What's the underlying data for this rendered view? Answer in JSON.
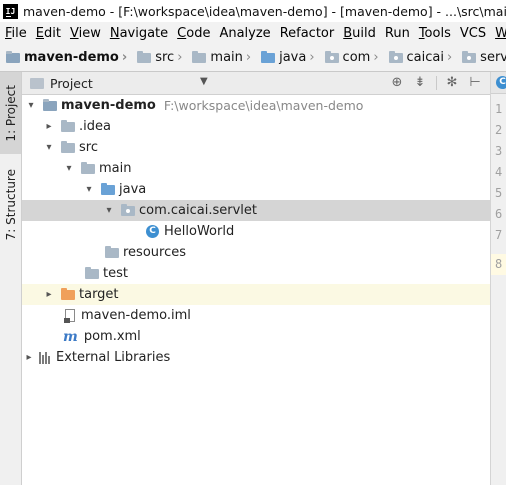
{
  "window": {
    "logo": "IJ",
    "title": "maven-demo - [F:\\workspace\\idea\\maven-demo] - [maven-demo] - ...\\src\\main\\java"
  },
  "menu": [
    {
      "mn": "F",
      "rest": "ile"
    },
    {
      "mn": "E",
      "rest": "dit"
    },
    {
      "mn": "V",
      "rest": "iew"
    },
    {
      "mn": "N",
      "rest": "avigate"
    },
    {
      "mn": "C",
      "rest": "ode"
    },
    {
      "mn": "",
      "rest": "Analyze"
    },
    {
      "mn": "",
      "rest": "Refactor"
    },
    {
      "mn": "B",
      "rest": "uild"
    },
    {
      "mn": "",
      "rest": "Run"
    },
    {
      "mn": "T",
      "rest": "ools"
    },
    {
      "mn": "",
      "rest": "VCS"
    },
    {
      "mn": "W",
      "rest": ""
    }
  ],
  "breadcrumbs": [
    "maven-demo",
    "src",
    "main",
    "java",
    "com",
    "caicai",
    "servlet",
    "C"
  ],
  "sidebar": {
    "project_tab": "1: Project",
    "structure_tab": "7: Structure"
  },
  "project_panel": {
    "title": "Project",
    "tools": [
      "target-icon",
      "collapse-icon",
      "gear-icon",
      "hide-icon"
    ]
  },
  "tree": {
    "root": {
      "label": "maven-demo",
      "path": "F:\\workspace\\idea\\maven-demo"
    },
    "idea": ".idea",
    "src": "src",
    "main": "main",
    "java": "java",
    "package": "com.caicai.servlet",
    "class_file": "HelloWorld",
    "resources": "resources",
    "test": "test",
    "target": "target",
    "iml": "maven-demo.iml",
    "pom": "pom.xml",
    "external": "External Libraries"
  },
  "editor": {
    "line_numbers": [
      "1",
      "2",
      "3",
      "4",
      "5",
      "6",
      "7",
      "8"
    ],
    "current_line": "8"
  },
  "colors": {
    "selection": "#d5d5d5",
    "excluded": "#fbf9e3",
    "source_folder": "#6aa2d6",
    "excluded_folder": "#f0a05a",
    "class_icon": "#3d8fd1"
  }
}
